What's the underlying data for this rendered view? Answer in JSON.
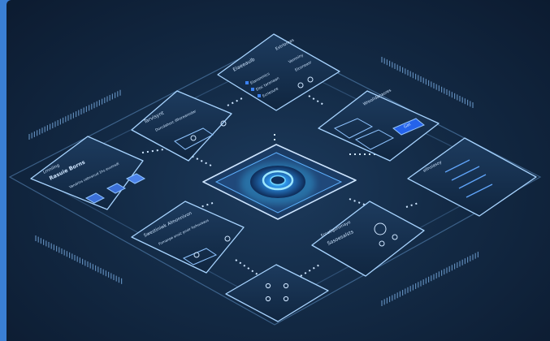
{
  "colors": {
    "background": "#132a45",
    "panel": "#16314f",
    "panel_edge": "#8fc4ff",
    "accent": "#3b82f6",
    "glow": "#38bdf8"
  },
  "panels": {
    "top": {
      "title": "Elaeeaulb",
      "col_right_title": "Extrlomas",
      "items": [
        "Elanonmics",
        "Eloc taronaan",
        "Ecriesure"
      ],
      "items_right": [
        "Vomniny",
        "Elconeasr"
      ]
    },
    "left_upper": {
      "title": "Tarvisynt",
      "subtitle": "Dorcdahorc illhsreanodar"
    },
    "left": {
      "title": "Lrnniiing",
      "heading": "Rasuie Borns",
      "caption": "Vandrins celmsnud 1hs evumsdi"
    },
    "right_upper": {
      "title": "Wreolldanasres",
      "button": "Gat"
    },
    "right": {
      "title": "ellnsiasoy"
    },
    "lower_left": {
      "title": "Swestiniwk Almonnivon",
      "caption": "Fomanpe  snoic pnoir forhoceaus"
    },
    "lower_right": {
      "title": "Fccotiguroinaye",
      "heading": "Sasoesalsts"
    },
    "center": {
      "icon": "power-ring-icon"
    }
  }
}
